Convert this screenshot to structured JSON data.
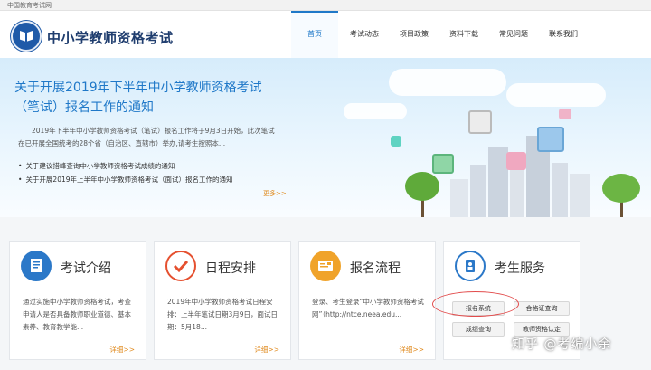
{
  "topbar": {
    "site_label": "中国教育考试网"
  },
  "header": {
    "title": "中小学教师资格考试",
    "nav": [
      {
        "label": "首页",
        "active": true
      },
      {
        "label": "考试动态"
      },
      {
        "label": "项目政策"
      },
      {
        "label": "资料下载"
      },
      {
        "label": "常见问题"
      },
      {
        "label": "联系我们"
      }
    ]
  },
  "banner": {
    "headline": "关于开展2019年下半年中小学教师资格考试（笔试）报名工作的通知",
    "summary": "2019年下半年中小学教师资格考试（笔试）报名工作将于9月3日开始，此次笔试在已开展全国统考的28个省（自治区、直辖市）举办,请考生按照本...",
    "links": [
      "关于建议措峰查询中小学教师资格考试成绩的通知",
      "关于开展2019年上半年中小学教师资格考试（面试）报名工作的通知"
    ],
    "more": "更多>>"
  },
  "cards": [
    {
      "title": "考试介绍",
      "text": "通过实施中小学教师资格考试，考查申请人是否具备教师职业道德、基本素养、教育教学能...",
      "more": "详细>>",
      "icon": "document-icon",
      "color": "#2b78c8"
    },
    {
      "title": "日程安排",
      "text": "2019年中小学教师资格考试日程安排：上半年笔试日期3月9日，面试日期：5月18...",
      "more": "详细>>",
      "icon": "checkmark-icon",
      "color": "#e5502f"
    },
    {
      "title": "报名流程",
      "text": "登录、考生登录“中小学教师资格考试网”（http://ntce.neea.edu...",
      "more": "详细>>",
      "icon": "application-form-icon",
      "color": "#f0a32a"
    },
    {
      "title": "考生服务",
      "icon": "contact-card-icon",
      "color": "#2b78c8",
      "buttons": [
        "报名系统",
        "合格证查询",
        "成绩查询",
        "教师资格认定"
      ]
    }
  ],
  "watermark": "知乎 @考编小余"
}
